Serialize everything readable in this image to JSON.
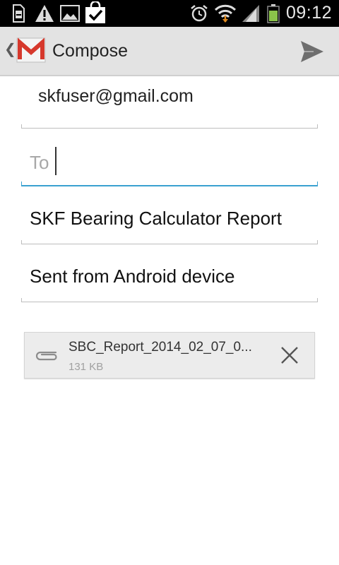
{
  "status_bar": {
    "time": "09:12",
    "icons": [
      "sd-card-icon",
      "warning-icon",
      "gallery-icon",
      "shopping-bag-check-icon",
      "alarm-icon",
      "wifi-icon",
      "signal-icon",
      "battery-icon"
    ]
  },
  "action_bar": {
    "title": "Compose",
    "app_icon": "gmail-icon",
    "up_icon": "chevron-left-icon",
    "send_icon": "send-icon"
  },
  "compose": {
    "from": "skfuser@gmail.com",
    "to": {
      "placeholder": "To",
      "value": ""
    },
    "subject": "SKF Bearing Calculator Report",
    "body": "Sent from Android device"
  },
  "attachment": {
    "name": "SBC_Report_2014_02_07_0...",
    "size": "131 KB",
    "icon": "paperclip-icon",
    "remove_icon": "close-icon"
  },
  "colors": {
    "accent": "#3aa1d0",
    "action_bar_bg": "#e3e3e3",
    "gmail_red": "#d6382c"
  }
}
